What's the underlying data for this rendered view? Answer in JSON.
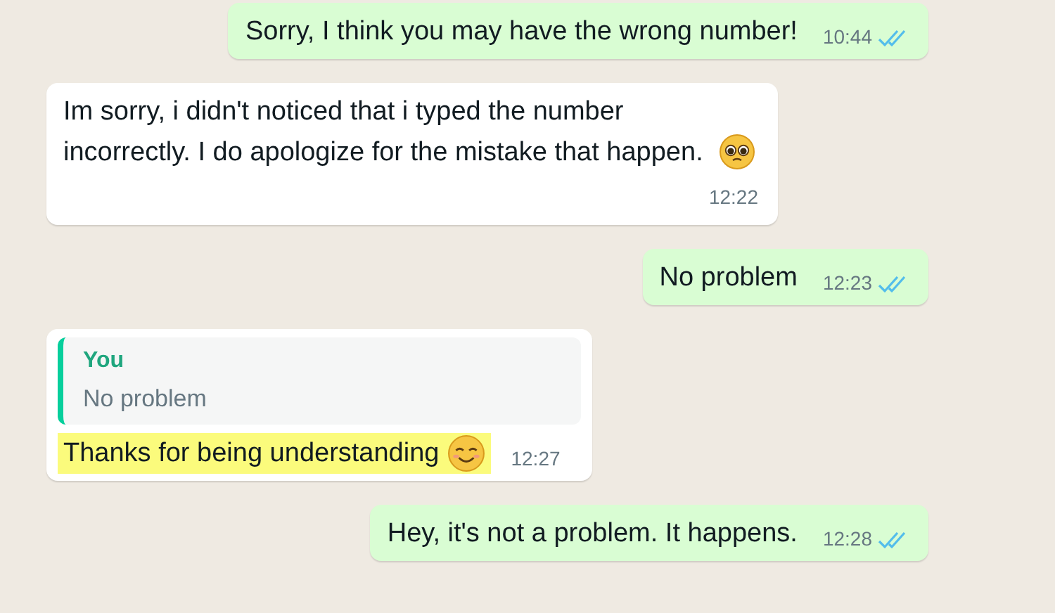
{
  "messages": [
    {
      "kind": "outgoing",
      "text": "Sorry, I think you may have the wrong number!",
      "time": "10:44",
      "read": true
    },
    {
      "kind": "incoming",
      "text": "Im sorry, i didn't noticed that i typed the number incorrectly. I do apologize for the mistake that happen.",
      "emoji": {
        "kind": "pleading"
      },
      "time": "12:22"
    },
    {
      "kind": "outgoing",
      "text": "No problem",
      "time": "12:23",
      "read": true
    },
    {
      "kind": "incoming",
      "quote": {
        "author": "You",
        "text": "No problem"
      },
      "text": "Thanks for being understanding",
      "emoji": {
        "kind": "smiling"
      },
      "highlighted": true,
      "time": "12:27"
    },
    {
      "kind": "outgoing",
      "text": "Hey, it's not a problem. It happens.",
      "time": "12:28",
      "read": true
    }
  ]
}
